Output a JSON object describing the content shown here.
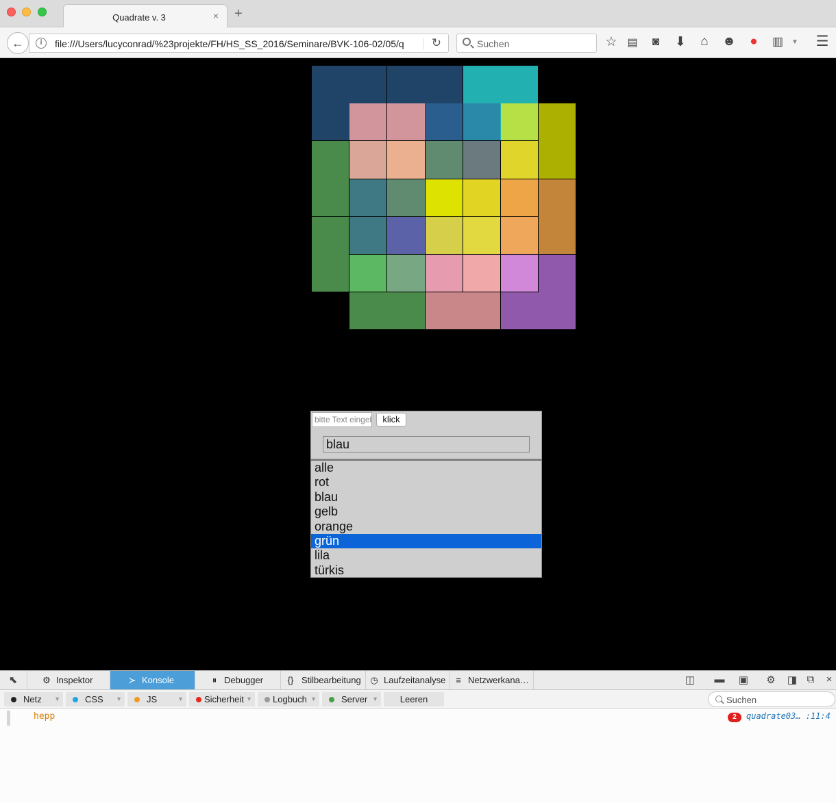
{
  "window": {
    "tab_title": "Quadrate v. 3",
    "tab_close": "×",
    "new_tab": "+"
  },
  "navbar": {
    "url": "file:///Users/lucyconrad/%23projekte/FH/HS_SS_2016/Seminare/BVK-106-02/05/q",
    "search_placeholder": "Suchen"
  },
  "squares": {
    "colors": [
      "#1f4468",
      "#1f4468",
      "#22b0b0",
      "#d3959c",
      "#d3959c",
      "#2a5e8f",
      "#2a88a8",
      "#b6e045",
      "#acb000",
      "#4a8a4a",
      "#daa698",
      "#ebb08f",
      "#608b70",
      "#6b7a7e",
      "#e0d52a",
      "#acb000",
      "#3f7a84",
      "#608b70",
      "#dde200",
      "#e2d422",
      "#eea548",
      "#c3853a",
      "#4a8a4a",
      "#3f7a84",
      "#5b62a8",
      "#d6cf4a",
      "#e2d840",
      "#efa85b",
      "#c3853a",
      "#5cb862",
      "#78a784",
      "#e79baf",
      "#f0a8a9",
      "#d288d9",
      "#9059ac",
      "#4a8a4a",
      "#c98789",
      "#9059ac"
    ]
  },
  "controls": {
    "text_input_placeholder": "bitte Text eingeben",
    "button_label": "klick",
    "value_field": "blau"
  },
  "color_list": {
    "items": [
      "alle",
      "rot",
      "blau",
      "gelb",
      "orange",
      "grün",
      "lila",
      "türkis"
    ],
    "selected": "grün"
  },
  "devtools": {
    "tabs": [
      "Inspektor",
      "Konsole",
      "Debugger",
      "Stilbearbeitung",
      "Laufzeitanalyse",
      "Netzwerkana…"
    ],
    "active_tab": "Konsole",
    "filters": [
      "Netz",
      "CSS",
      "JS",
      "Sicherheit",
      "Logbuch",
      "Server"
    ],
    "filter_colors": [
      "#222222",
      "#1ea7e0",
      "#f29a1c",
      "#e3281f",
      "#9a9a9a",
      "#45a042"
    ],
    "clear_label": "Leeren",
    "search_placeholder": "Suchen",
    "log": {
      "message": "hepp",
      "count": "2",
      "source": "quadrate03… :11:4"
    }
  }
}
